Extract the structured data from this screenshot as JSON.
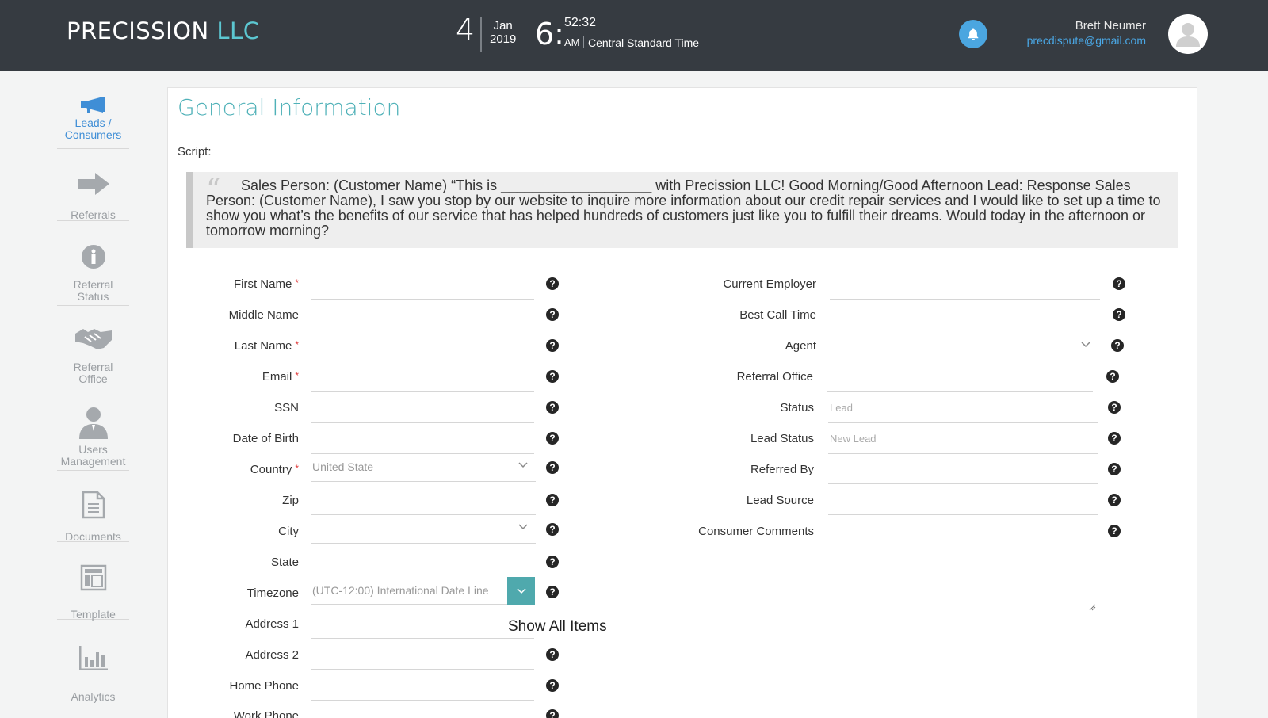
{
  "header": {
    "brand_main": "PRECISSION",
    "brand_suffix": "LLC",
    "clock": {
      "day": "4",
      "month": "Jan",
      "year": "2019",
      "hour": "6:",
      "seconds": "52:32",
      "ampm": "AM",
      "timezone": "Central Standard Time"
    },
    "user_name": "Brett Neumer",
    "user_email": "precdispute@gmail.com",
    "icons": {
      "bell": "bell-icon",
      "avatar": "user-avatar-icon"
    },
    "colors": {
      "bar": "#363b41",
      "accent": "#5cc7d1",
      "bell": "#4ba6e0"
    }
  },
  "sidebar": {
    "items": [
      {
        "label": "Leads / Consumers",
        "icon": "megaphone-icon",
        "active": true
      },
      {
        "label": "Referrals",
        "icon": "arrow-right-icon",
        "active": false
      },
      {
        "label": "Referral Status",
        "icon": "info-icon",
        "active": false
      },
      {
        "label": "Referral Office",
        "icon": "handshake-icon",
        "active": false
      },
      {
        "label": "Users Management",
        "icon": "user-icon",
        "active": false
      },
      {
        "label": "Documents",
        "icon": "document-icon",
        "active": false
      },
      {
        "label": "Template",
        "icon": "template-icon",
        "active": false
      },
      {
        "label": "Analytics",
        "icon": "bar-chart-icon",
        "active": false
      }
    ]
  },
  "main": {
    "title": "General Information",
    "script_label": "Script:",
    "script_text": "Sales Person: (Customer Name) “This is ___________________ with Precission LLC! Good Morning/Good Afternoon Lead: Response Sales Person: (Customer Name), I saw you stop by our website to inquire more information about our credit repair services and I would like to set up a time to show you what’s the benefits of our service that has helped hundreds of customers just like you to fulfill their dreams. Would today in the afternoon or tomorrow morning?",
    "left_fields": [
      {
        "label": "First Name",
        "required": true,
        "value": ""
      },
      {
        "label": "Middle Name",
        "required": false,
        "value": ""
      },
      {
        "label": "Last Name",
        "required": true,
        "value": ""
      },
      {
        "label": "Email",
        "required": true,
        "value": ""
      },
      {
        "label": "SSN",
        "required": false,
        "value": ""
      },
      {
        "label": "Date of Birth",
        "required": false,
        "value": ""
      },
      {
        "label": "Country",
        "required": true,
        "value": "United State"
      },
      {
        "label": "Zip",
        "required": false,
        "value": ""
      },
      {
        "label": "City",
        "required": false,
        "value": ""
      },
      {
        "label": "State",
        "required": false,
        "value": ""
      },
      {
        "label": "Timezone",
        "required": false,
        "value": "(UTC-12:00) International Date Line"
      },
      {
        "label": "Address 1",
        "required": false,
        "value": ""
      },
      {
        "label": "Address 2",
        "required": false,
        "value": ""
      },
      {
        "label": "Home Phone",
        "required": false,
        "value": ""
      },
      {
        "label": "Work Phone",
        "required": false,
        "value": ""
      }
    ],
    "right_fields": [
      {
        "label": "Current Employer",
        "value": ""
      },
      {
        "label": "Best Call Time",
        "value": ""
      },
      {
        "label": "Agent",
        "value": ""
      },
      {
        "label": "Referral Office",
        "value": ""
      },
      {
        "label": "Status",
        "value": "Lead"
      },
      {
        "label": "Lead Status",
        "value": "New Lead"
      },
      {
        "label": "Referred By",
        "value": ""
      },
      {
        "label": "Lead Source",
        "value": ""
      },
      {
        "label": "Consumer Comments",
        "value": ""
      }
    ],
    "tooltip": "Show All Items",
    "help_glyph": "?",
    "required_mark": "*",
    "colors": {
      "title": "#4fb1b8",
      "timezone_button": "#4fa9ad",
      "required": "#e03a3a"
    }
  }
}
